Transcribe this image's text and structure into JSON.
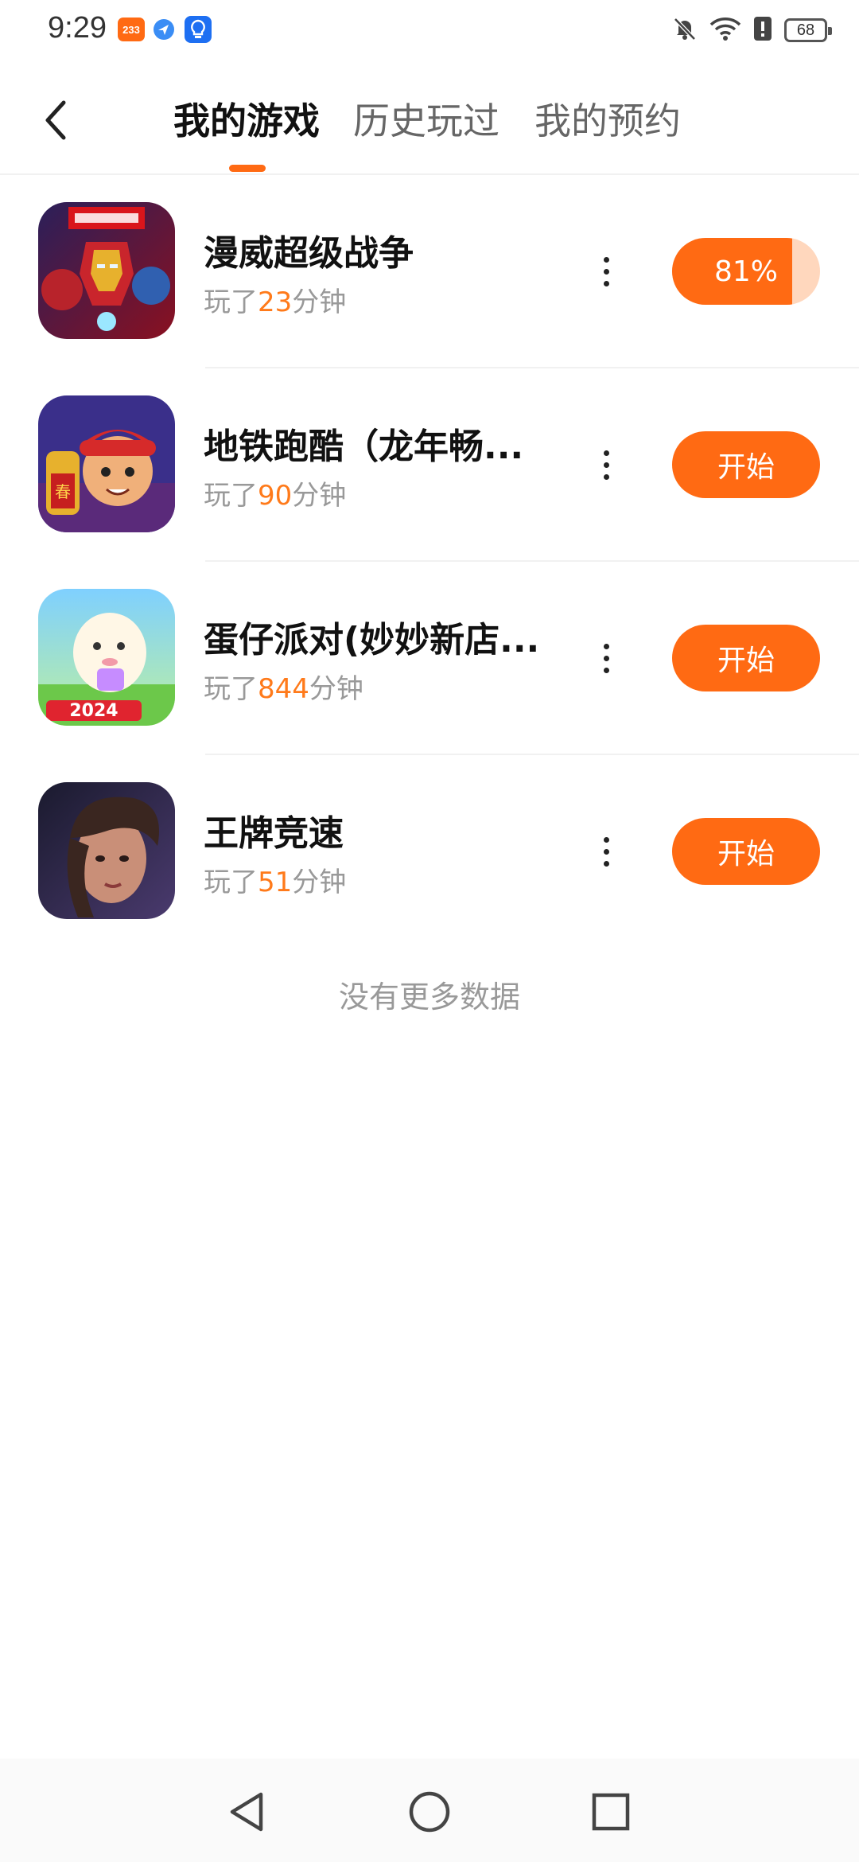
{
  "status_bar": {
    "time": "9:29",
    "badge_233": "233",
    "battery": "68",
    "icons": [
      "app-233-icon",
      "blue-app-icon",
      "lightbulb-icon",
      "bell-muted-icon",
      "wifi-icon",
      "alert-icon",
      "battery-icon"
    ]
  },
  "header": {
    "back_icon": "back-arrow-icon",
    "tabs": [
      {
        "label": "我的游戏",
        "active": true
      },
      {
        "label": "历史玩过",
        "active": false
      },
      {
        "label": "我的预约",
        "active": false
      }
    ]
  },
  "games": [
    {
      "title": "漫威超级战争",
      "played_prefix": "玩了",
      "minutes": "23",
      "played_suffix": "分钟",
      "action_type": "progress",
      "action_label": "81%",
      "progress": 0.81,
      "icon": "marvel-game-icon"
    },
    {
      "title": "地铁跑酷（龙年畅...",
      "played_prefix": "玩了",
      "minutes": "90",
      "played_suffix": "分钟",
      "action_type": "start",
      "action_label": "开始",
      "icon": "subway-surfers-icon"
    },
    {
      "title": "蛋仔派对(妙妙新店...",
      "played_prefix": "玩了",
      "minutes": "844",
      "played_suffix": "分钟",
      "action_type": "start",
      "action_label": "开始",
      "icon": "eggy-party-icon"
    },
    {
      "title": "王牌竞速",
      "played_prefix": "玩了",
      "minutes": "51",
      "played_suffix": "分钟",
      "action_type": "start",
      "action_label": "开始",
      "icon": "ace-racer-icon"
    }
  ],
  "footer_text": "没有更多数据",
  "colors": {
    "accent": "#ff6a13",
    "progress_track": "#ffd7bd",
    "minutes": "#ff7a1a"
  }
}
